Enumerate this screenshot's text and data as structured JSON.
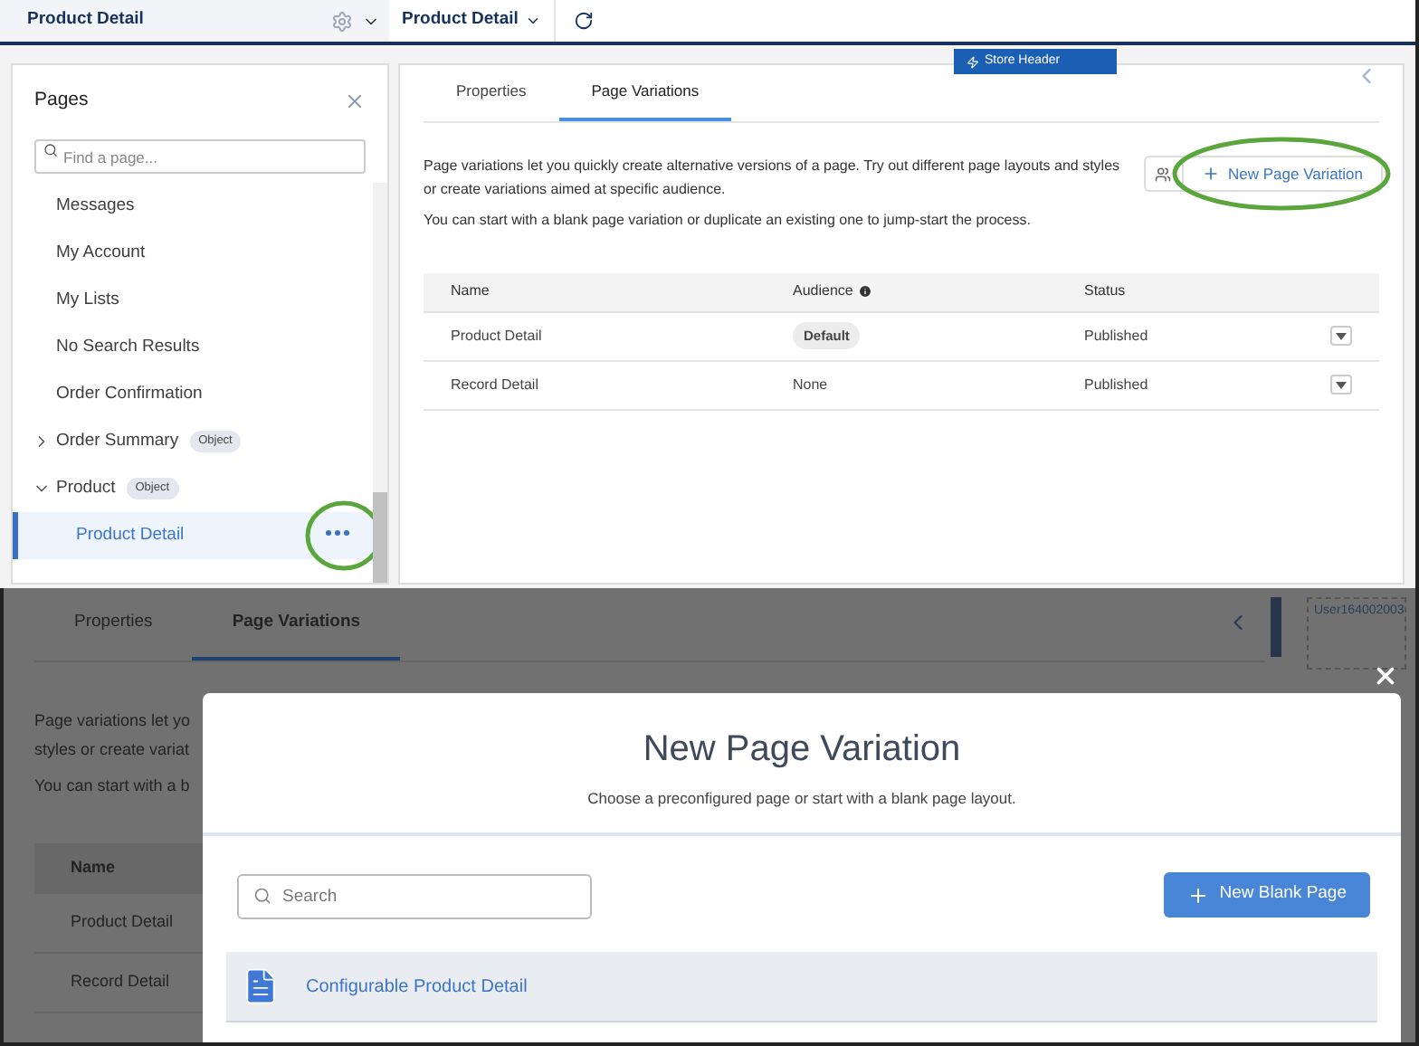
{
  "top_bar": {
    "page_title": "Product Detail",
    "variation_menu": "Product Detail"
  },
  "canvas": {
    "store_header": "Store Header"
  },
  "pages_panel": {
    "title": "Pages",
    "search": {
      "placeholder": "Find a page..."
    },
    "items": [
      {
        "label": "Messages",
        "selected": false
      },
      {
        "label": "My Account",
        "selected": false
      },
      {
        "label": "My Lists",
        "selected": false
      },
      {
        "label": "No Search Results",
        "selected": false
      },
      {
        "label": "Order Confirmation",
        "selected": false
      },
      {
        "label": "Order Summary",
        "badge": "Object",
        "expanded": false,
        "selected": false
      },
      {
        "label": "Product",
        "badge": "Object",
        "expanded": true,
        "selected": false,
        "children": [
          {
            "label": "Product Detail",
            "selected": true
          }
        ]
      }
    ]
  },
  "properties_panel": {
    "tabs": [
      {
        "label": "Properties",
        "selected": false
      },
      {
        "label": "Page Variations",
        "selected": true
      }
    ],
    "description": [
      "Page variations let you quickly create alternative versions of a page. Try out different page layouts and styles or create variations aimed at specific audience.",
      "You can start with a blank page variation or duplicate an existing one to jump-start the process."
    ],
    "new_button": "New Page Variation",
    "table": {
      "columns": [
        "Name",
        "Audience",
        "Status"
      ],
      "rows": [
        {
          "name": "Product Detail",
          "audience": "Default",
          "kind": "badge",
          "status": "Published"
        },
        {
          "name": "Record Detail",
          "audience": "None",
          "kind": "text",
          "status": "Published"
        }
      ]
    }
  },
  "background": {
    "tabs": [
      {
        "label": "Properties",
        "selected": false
      },
      {
        "label": "Page Variations",
        "selected": true
      }
    ],
    "description": [
      "Page variations let yo",
      "styles or create variat",
      "You can start with a b"
    ],
    "table": {
      "column": "Name",
      "rows": [
        "Product Detail",
        "Record Detail"
      ]
    },
    "user": "User164002003"
  },
  "modal": {
    "title": "New Page Variation",
    "subtitle": "Choose a preconfigured page or start with a blank page layout.",
    "search": {
      "placeholder": "Search"
    },
    "new_button": "New Blank Page",
    "templates": [
      {
        "label": "Configurable Product Detail",
        "selected": true
      }
    ]
  }
}
